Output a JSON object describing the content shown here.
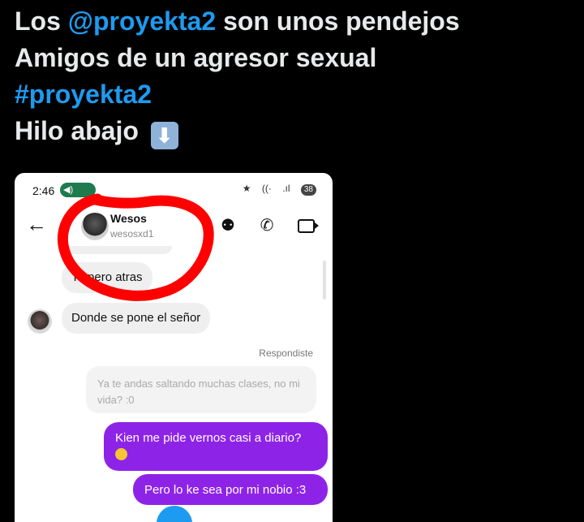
{
  "tweet": {
    "line1_prefix": "Los ",
    "line1_mention": "@proyekta2",
    "line1_suffix": " son unos pendejos",
    "line2": "Amigos de un agresor sexual",
    "line3_hashtag": "#proyekta2",
    "line4": "Hilo abajo",
    "arrow_glyph": "⬇"
  },
  "screenshot": {
    "status": {
      "time": "2:46",
      "battery": "38"
    },
    "header": {
      "back_glyph": "←",
      "contact_name": "Wesos",
      "contact_username": "wesosxd1"
    },
    "messages": {
      "incoming_1": "Te pero atras",
      "incoming_2": "Donde se pone el señor",
      "replied_label": "Respondiste",
      "reply_quote": "Ya te andas saltando muchas clases, no mi vida? :0",
      "outgoing_1": "Kien me pide vernos casi a diario?",
      "outgoing_2": "Pero lo ke sea por mi nobio :3"
    }
  },
  "colors": {
    "background": "#000000",
    "tweet_text": "#e7e9ea",
    "link_blue": "#1d9bf0",
    "outgoing_bubble": "#8e23e8",
    "annotation_red": "#ff0000"
  },
  "icons": [
    "back-arrow-icon",
    "effects-icon",
    "phone-icon",
    "video-icon",
    "down-arrow-emoji",
    "star-icon",
    "wifi-icon",
    "signal-icon",
    "battery-icon"
  ]
}
